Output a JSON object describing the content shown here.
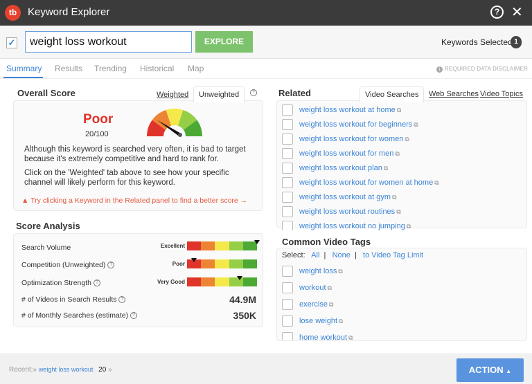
{
  "window": {
    "title": "Keyword Explorer",
    "logo": "tb"
  },
  "search": {
    "value": "weight loss workout",
    "explore_label": "EXPLORE",
    "keywords_selected_label": "Keywords Selected",
    "keywords_selected_count": "1"
  },
  "tabs": [
    {
      "label": "Summary"
    },
    {
      "label": "Results"
    },
    {
      "label": "Trending"
    },
    {
      "label": "Historical"
    },
    {
      "label": "Map"
    }
  ],
  "disclaimer": "REQUIRED DATA DISCLAIMER",
  "overall": {
    "title": "Overall Score",
    "tab_weighted": "Weighted",
    "tab_unweighted": "Unweighted",
    "rating": "Poor",
    "score": "20/100",
    "score_value": 20,
    "desc1": "Although this keyword is searched very often, it is bad to target because it's extremely competitive and hard to rank for.",
    "desc2": "Click on the 'Weighted' tab above to see how your specific channel will likely perform for this keyword.",
    "tip": "Try clicking a Keyword in the Related panel to find a better score →"
  },
  "analysis": {
    "title": "Score Analysis",
    "rows": [
      {
        "label": "Search Volume",
        "rating": "Excellent",
        "level": 1.0
      },
      {
        "label": "Competition (Unweighted)",
        "rating": "Poor",
        "level": 0.1
      },
      {
        "label": "Optimization Strength",
        "rating": "Very Good",
        "level": 0.75
      }
    ],
    "videos_label": "# of Videos in Search Results",
    "videos_value": "44.9M",
    "monthly_label": "# of Monthly Searches (estimate)",
    "monthly_value": "350K"
  },
  "colors": {
    "red": "#e0342b",
    "orange": "#ec8434",
    "yellow": "#f5e84a",
    "lightgreen": "#94cf45",
    "green": "#4caa34",
    "accent": "#3b84d6"
  },
  "related": {
    "title": "Related",
    "tabs": [
      "Video Searches",
      "Web Searches",
      "Video Topics"
    ],
    "items": [
      "weight loss workout at home",
      "weight loss workout for beginners",
      "weight loss workout for women",
      "weight loss workout for men",
      "weight loss workout plan",
      "weight loss workout for women at home",
      "weight loss workout at gym",
      "weight loss workout routines",
      "weight loss workout no jumping"
    ]
  },
  "tags": {
    "title": "Common Video Tags",
    "select_label": "Select:",
    "all": "All",
    "none": "None",
    "limit": "to Video Tag Limit",
    "items": [
      "weight loss",
      "workout",
      "exercise",
      "lose weight",
      "home workout"
    ]
  },
  "footer": {
    "recent_label": "Recent:»",
    "recent_link": "weight loss workout",
    "recent_count": "20",
    "more": "»",
    "action_label": "ACTION"
  }
}
